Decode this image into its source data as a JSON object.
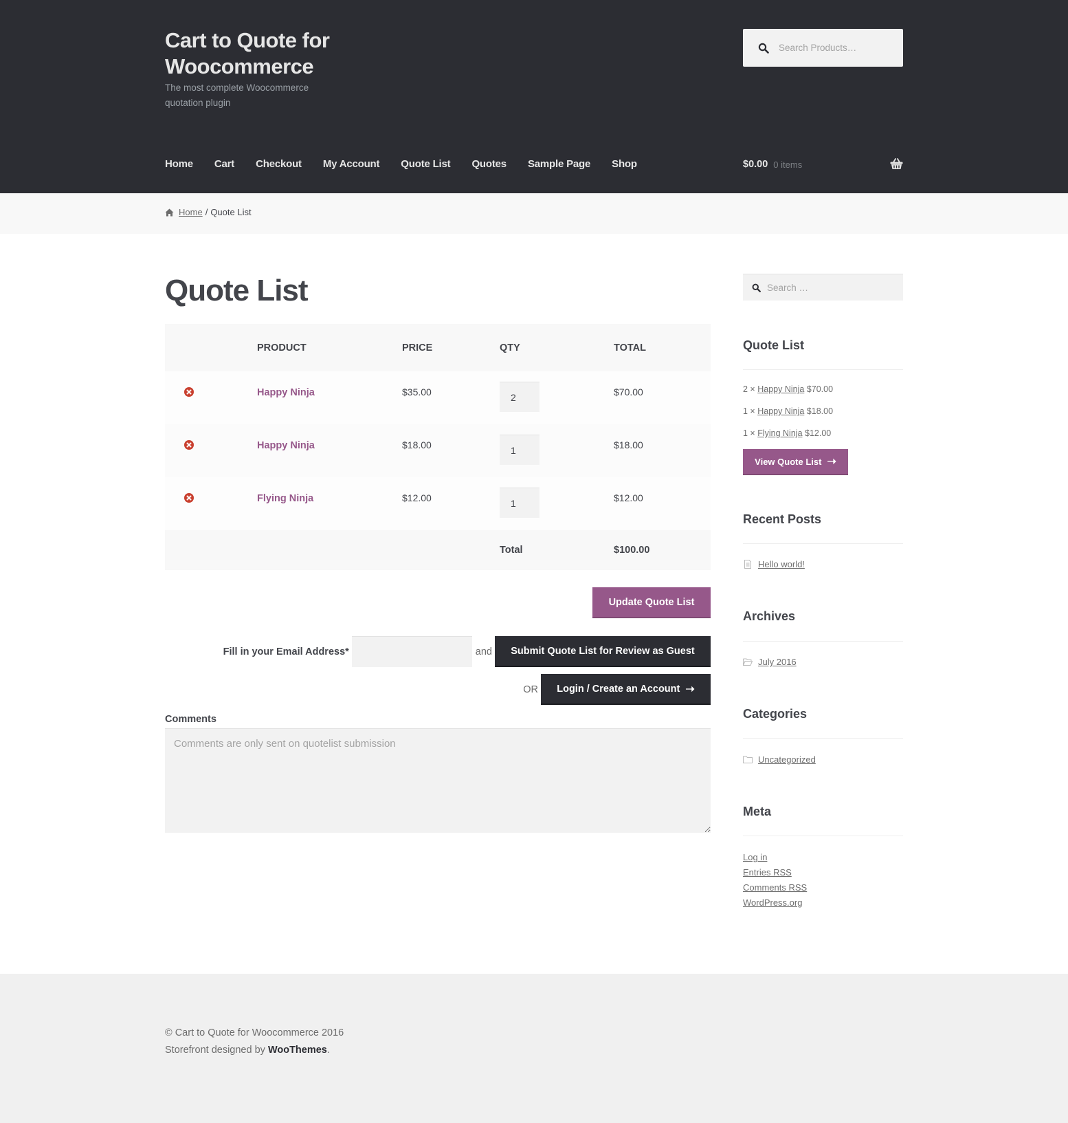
{
  "header": {
    "site_title": "Cart to Quote for Woocommerce",
    "site_description": "The most complete Woocommerce quotation plugin",
    "search_placeholder": "Search Products…",
    "nav": [
      {
        "label": "Home"
      },
      {
        "label": "Cart"
      },
      {
        "label": "Checkout"
      },
      {
        "label": "My Account"
      },
      {
        "label": "Quote List"
      },
      {
        "label": "Quotes"
      },
      {
        "label": "Sample Page"
      },
      {
        "label": "Shop"
      }
    ],
    "cart": {
      "amount": "$0.00",
      "count": "0 items"
    }
  },
  "breadcrumb": {
    "home": "Home",
    "separator": "/",
    "current": "Quote List"
  },
  "main": {
    "title": "Quote List",
    "table": {
      "headers": [
        "",
        "Product",
        "Price",
        "Qty",
        "Total"
      ],
      "rows": [
        {
          "product": "Happy Ninja",
          "price": "$35.00",
          "qty": "2",
          "total": "$70.00"
        },
        {
          "product": "Happy Ninja",
          "price": "$18.00",
          "qty": "1",
          "total": "$18.00"
        },
        {
          "product": "Flying Ninja",
          "price": "$12.00",
          "qty": "1",
          "total": "$12.00"
        }
      ],
      "total_label": "Total",
      "total_value": "$100.00"
    },
    "update_button": "Update Quote List",
    "email_label": "Fill in your Email Address*",
    "email_value": "",
    "and_text": "and",
    "submit_button": "Submit Quote List for Review as Guest",
    "or_text": "OR",
    "login_button": "Login / Create an Account",
    "arrow": "➝",
    "comments_label": "Comments",
    "comments_placeholder": "Comments are only sent on quotelist submission",
    "comments_value": ""
  },
  "sidebar": {
    "search_placeholder": "Search …",
    "quote_list": {
      "title": "Quote List",
      "items": [
        {
          "qty": "2 ×",
          "product": "Happy Ninja",
          "price": "$70.00"
        },
        {
          "qty": "1 ×",
          "product": "Happy Ninja",
          "price": "$18.00"
        },
        {
          "qty": "1 ×",
          "product": "Flying Ninja",
          "price": "$12.00"
        }
      ],
      "button": "View Quote List"
    },
    "recent_posts": {
      "title": "Recent Posts",
      "items": [
        "Hello world!"
      ]
    },
    "archives": {
      "title": "Archives",
      "items": [
        "July 2016"
      ]
    },
    "categories": {
      "title": "Categories",
      "items": [
        "Uncategorized"
      ]
    },
    "meta": {
      "title": "Meta",
      "log_in": "Log in",
      "entries": "Entries",
      "comments": "Comments",
      "rss": "RSS",
      "wordpress": "WordPress.org"
    }
  },
  "footer": {
    "copyright": "© Cart to Quote for Woocommerce 2016",
    "designed_by": "Storefront designed by",
    "brand": "WooThemes",
    "period": "."
  },
  "colors": {
    "header_bg": "#2c2d33",
    "accent_purple": "#96588a",
    "remove_red": "#c9402f",
    "footer_bg": "#f0f0f0"
  }
}
